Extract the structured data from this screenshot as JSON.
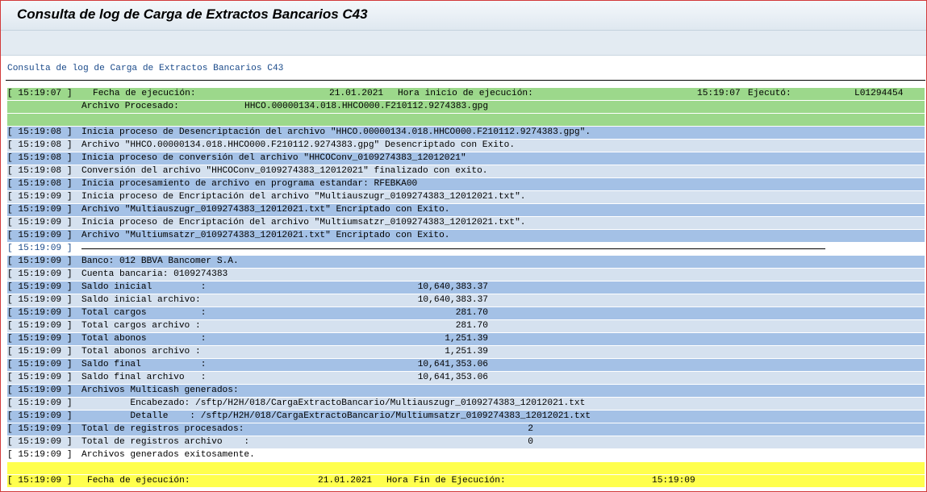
{
  "window": {
    "title": "Consulta de log de Carga de Extractos Bancarios C43"
  },
  "report": {
    "subtitle": "Consulta de log de Carga de Extractos Bancarios C43",
    "header": {
      "ts": "[ 15:19:07 ]",
      "fecha_label": "Fecha de ejecución:",
      "fecha": "21.01.2021",
      "hora_label": "Hora inicio de ejecución:",
      "hora": "15:19:07",
      "ejecuto_label": "Ejecutó:",
      "ejecuto": "L01294454",
      "archivo_label": "Archivo Procesado:",
      "archivo": "HHCO.00000134.018.HHCO000.F210112.9274383.gpg"
    },
    "log": [
      {
        "ts": "[ 15:19:08 ]",
        "text": "Inicia proceso de Desencriptación del archivo \"HHCO.00000134.018.HHCO000.F210112.9274383.gpg\"."
      },
      {
        "ts": "[ 15:19:08 ]",
        "text": "Archivo \"HHCO.00000134.018.HHCO000.F210112.9274383.gpg\" Desencriptado con Exito."
      },
      {
        "ts": "[ 15:19:08 ]",
        "text": "Inicia proceso de conversión del archivo \"HHCOConv_0109274383_12012021\""
      },
      {
        "ts": "[ 15:19:08 ]",
        "text": "Conversión del archivo \"HHCOConv_0109274383_12012021\" finalizado con exito."
      },
      {
        "ts": "[ 15:19:08 ]",
        "text": "Inicia procesamiento de archivo en programa estandar: RFEBKA00"
      },
      {
        "ts": "[ 15:19:09 ]",
        "text": "Inicia proceso de Encriptación del archivo \"Multiauszugr_0109274383_12012021.txt\"."
      },
      {
        "ts": "[ 15:19:09 ]",
        "text": "Archivo \"Multiauszugr_0109274383_12012021.txt\" Encriptado con Exito."
      },
      {
        "ts": "[ 15:19:09 ]",
        "text": "Inicia proceso de Encriptación del archivo \"Multiumsatzr_0109274383_12012021.txt\"."
      },
      {
        "ts": "[ 15:19:09 ]",
        "text": "Archivo \"Multiumsatzr_0109274383_12012021.txt\" Encriptado con Exito."
      }
    ],
    "divider_ts": "[ 15:19:09 ]",
    "summary": [
      {
        "ts": "[ 15:19:09 ]",
        "text": "Banco: 012 BBVA Bancomer S.A.",
        "value": ""
      },
      {
        "ts": "[ 15:19:09 ]",
        "text": "Cuenta bancaria: 0109274383",
        "value": ""
      },
      {
        "ts": "[ 15:19:09 ]",
        "text": "Saldo inicial         :",
        "value": "10,640,383.37"
      },
      {
        "ts": "[ 15:19:09 ]",
        "text": "Saldo inicial archivo:",
        "value": "10,640,383.37"
      },
      {
        "ts": "[ 15:19:09 ]",
        "text": "Total cargos          :",
        "value": "281.70"
      },
      {
        "ts": "[ 15:19:09 ]",
        "text": "Total cargos archivo :",
        "value": "281.70"
      },
      {
        "ts": "[ 15:19:09 ]",
        "text": "Total abonos          :",
        "value": "1,251.39"
      },
      {
        "ts": "[ 15:19:09 ]",
        "text": "Total abonos archivo :",
        "value": "1,251.39"
      },
      {
        "ts": "[ 15:19:09 ]",
        "text": "Saldo final           :",
        "value": "10,641,353.06"
      },
      {
        "ts": "[ 15:19:09 ]",
        "text": "Saldo final archivo   :",
        "value": "10,641,353.06"
      },
      {
        "ts": "[ 15:19:09 ]",
        "text": "Archivos Multicash generados:",
        "value": ""
      },
      {
        "ts": "[ 15:19:09 ]",
        "text": "         Encabezado: /sftp/H2H/018/CargaExtractoBancario/Multiauszugr_0109274383_12012021.txt",
        "value": ""
      },
      {
        "ts": "[ 15:19:09 ]",
        "text": "         Detalle    : /sftp/H2H/018/CargaExtractoBancario/Multiumsatzr_0109274383_12012021.txt",
        "value": ""
      }
    ],
    "registros": [
      {
        "ts": "[ 15:19:09 ]",
        "text": "Total de registros procesados:",
        "value": "2"
      },
      {
        "ts": "[ 15:19:09 ]",
        "text": "Total de registros archivo    :",
        "value": "0"
      }
    ],
    "final_msg": {
      "ts": "[ 15:19:09 ]",
      "text": "Archivos generados exitosamente."
    },
    "footer": {
      "ts": "[ 15:19:09 ]",
      "fecha_label": "Fecha de ejecución:",
      "fecha": "21.01.2021",
      "hora_label": "Hora Fin de Ejecución:",
      "hora": "15:19:09"
    }
  }
}
